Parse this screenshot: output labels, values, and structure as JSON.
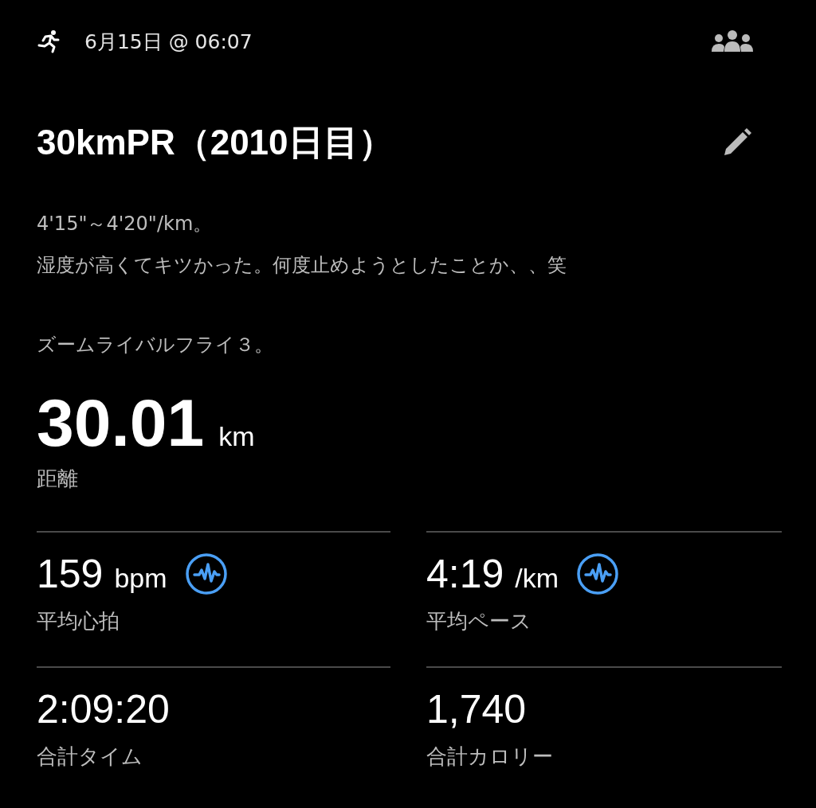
{
  "header": {
    "datetime": "6月15日 @ 06:07"
  },
  "title": "30kmPR（2010日目）",
  "description": [
    {
      "lines": [
        "4'15\"～4'20\"/km。",
        "湿度が高くてキツかった。何度止めようとしたことか、、笑"
      ]
    },
    {
      "lines": [
        "ズームライバルフライ３。"
      ]
    }
  ],
  "distance": {
    "value": "30.01",
    "unit": "km",
    "label": "距離"
  },
  "stats": [
    {
      "value": "159",
      "unit": "bpm",
      "label": "平均心拍",
      "detail_icon": true
    },
    {
      "value": "4:19",
      "unit": "/km",
      "label": "平均ペース",
      "detail_icon": true
    },
    {
      "value": "2:09:20",
      "label": "合計タイム",
      "detail_icon": false
    },
    {
      "value": "1,740",
      "label": "合計カロリー",
      "detail_icon": false
    }
  ]
}
